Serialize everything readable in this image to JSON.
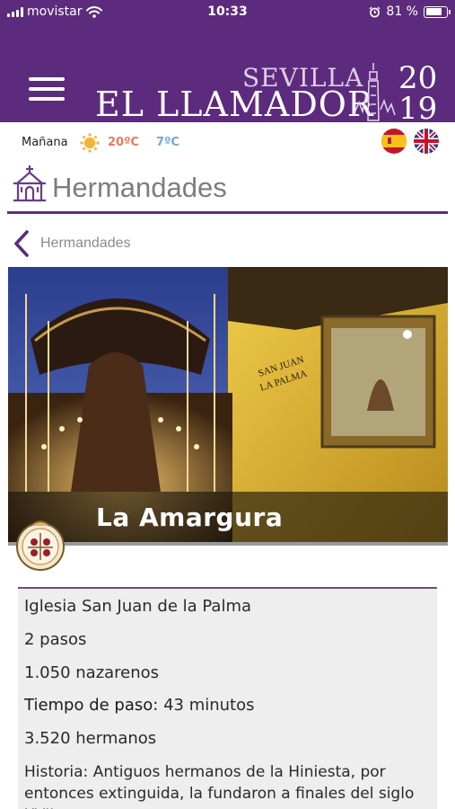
{
  "status_bar": {
    "carrier": "movistar",
    "time": "10:33",
    "battery": "81 %",
    "battery_level": 0.81
  },
  "brand": {
    "city": "SEVILLA",
    "name": "EL LLAMADOR",
    "year_top": "20",
    "year_bottom": "19"
  },
  "weather": {
    "label": "Mañana",
    "icon": "sun-icon",
    "high": "20ºC",
    "low": "7ºC"
  },
  "languages": [
    "es-flag-icon",
    "uk-flag-icon"
  ],
  "section": {
    "icon": "church-icon",
    "title": "Hermandades"
  },
  "back": {
    "label": "Hermandades"
  },
  "brotherhood": {
    "name": "La Amargura",
    "church": "Iglesia San Juan de la Palma",
    "pasos": "2 pasos",
    "nazarenos": "1.050 nazarenos",
    "tiempo_label": "Tiempo de paso:",
    "tiempo_value": "43 minutos",
    "hermanos": "3.520 hermanos",
    "historia_label": "Historia:",
    "historia_text": "Antiguos hermanos de la Hiniesta, por entonces extinguida, la fundaron a finales del siglo XVII"
  },
  "colors": {
    "brand_purple": "#5d2b7e",
    "temp_high": "#e87b5e",
    "temp_low": "#6aa9dc"
  }
}
